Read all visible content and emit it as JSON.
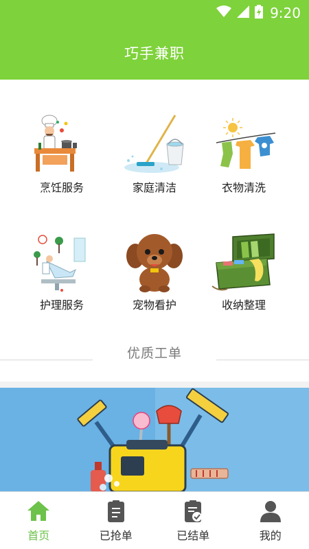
{
  "status_bar": {
    "time": "9:20"
  },
  "app_bar": {
    "title": "巧手兼职"
  },
  "services": [
    {
      "label": "烹饪服务",
      "icon": "chef-cooking-illustration"
    },
    {
      "label": "家庭清洁",
      "icon": "mop-bucket-illustration"
    },
    {
      "label": "衣物清洗",
      "icon": "clothesline-illustration"
    },
    {
      "label": "护理服务",
      "icon": "dental-care-illustration"
    },
    {
      "label": "宠物看护",
      "icon": "poodle-illustration"
    },
    {
      "label": "收纳整理",
      "icon": "storage-box-illustration"
    }
  ],
  "section": {
    "title": "优质工单"
  },
  "banner": {
    "theme": "cleaning-equipment-illustration"
  },
  "bottom_nav": {
    "active": "home",
    "items": [
      {
        "label": "首页",
        "icon": "home-icon"
      },
      {
        "label": "已抢单",
        "icon": "grabbed-orders-icon"
      },
      {
        "label": "已结单",
        "icon": "completed-orders-icon"
      },
      {
        "label": "我的",
        "icon": "profile-icon"
      }
    ]
  },
  "colors": {
    "primary": "#7ed23b",
    "nav_active": "#6cc24a",
    "text": "#222222",
    "muted": "#7a7a7a"
  }
}
